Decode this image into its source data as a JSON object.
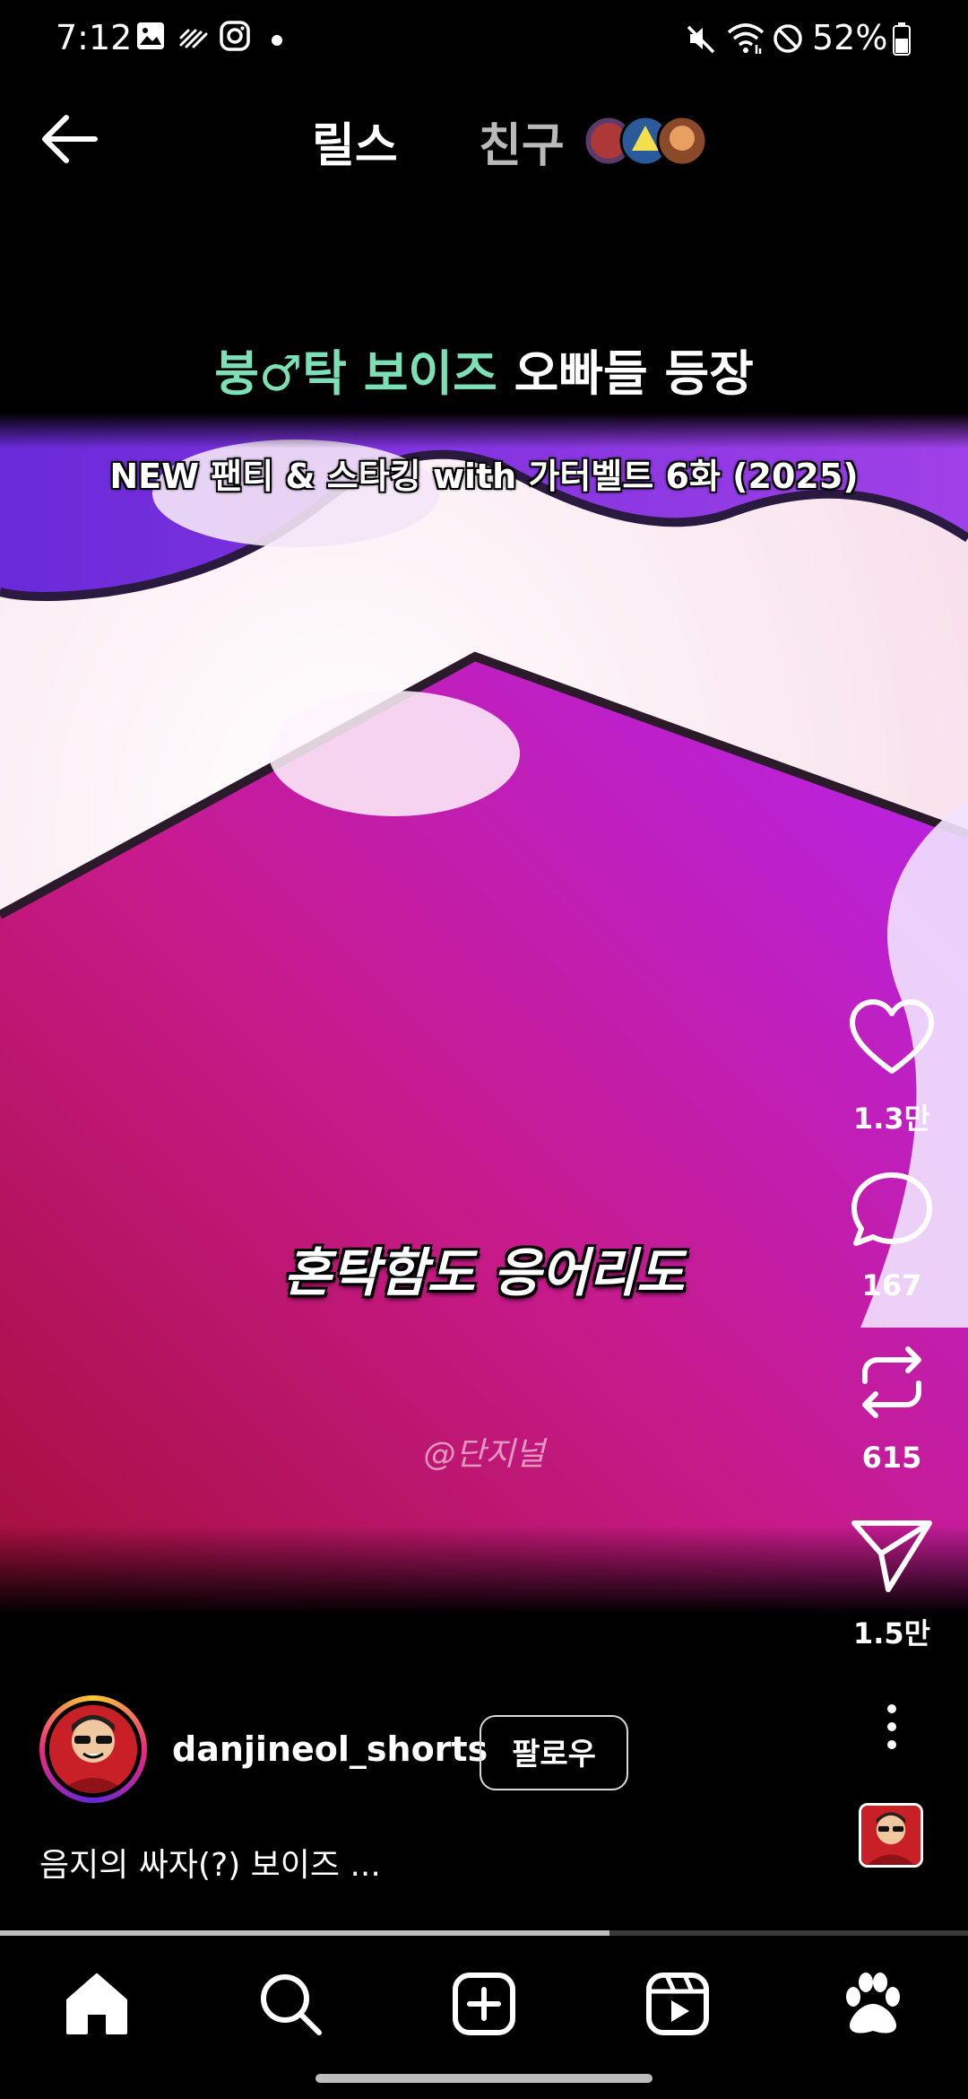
{
  "status_bar": {
    "time": "7:12",
    "battery": "52%",
    "left_icons": [
      "gallery-icon",
      "activity-icon",
      "instagram-icon",
      "dot-icon"
    ],
    "right_icons": [
      "mute-icon",
      "wifi-icon",
      "do-not-disturb-icon",
      "battery-icon"
    ]
  },
  "header": {
    "tab_reels": "릴스",
    "tab_friends": "친구"
  },
  "video": {
    "title_accent": "붕♂탁 보이즈",
    "title_rest": " 오빠들 등장",
    "subtitle": "NEW 팬티 & 스타킹 with 가터벨트 6화 (2025)",
    "caption": "혼탁함도 응어리도",
    "watermark": "@단지널"
  },
  "actions": {
    "likes": "1.3만",
    "comments": "167",
    "reposts": "615",
    "shares": "1.5만"
  },
  "post": {
    "username": "danjineol_shorts",
    "follow_label": "팔로우",
    "caption": "음지의 싸자(?) 보이즈 ..."
  },
  "progress": {
    "fraction": 0.63
  },
  "nav": [
    "home-icon",
    "search-icon",
    "create-icon",
    "reels-icon",
    "paw-icon"
  ],
  "colors": {
    "accent_title": "#7ddfb6",
    "background": "#000000",
    "video_purple": "#a02ed0",
    "video_magenta": "#c4124f"
  }
}
